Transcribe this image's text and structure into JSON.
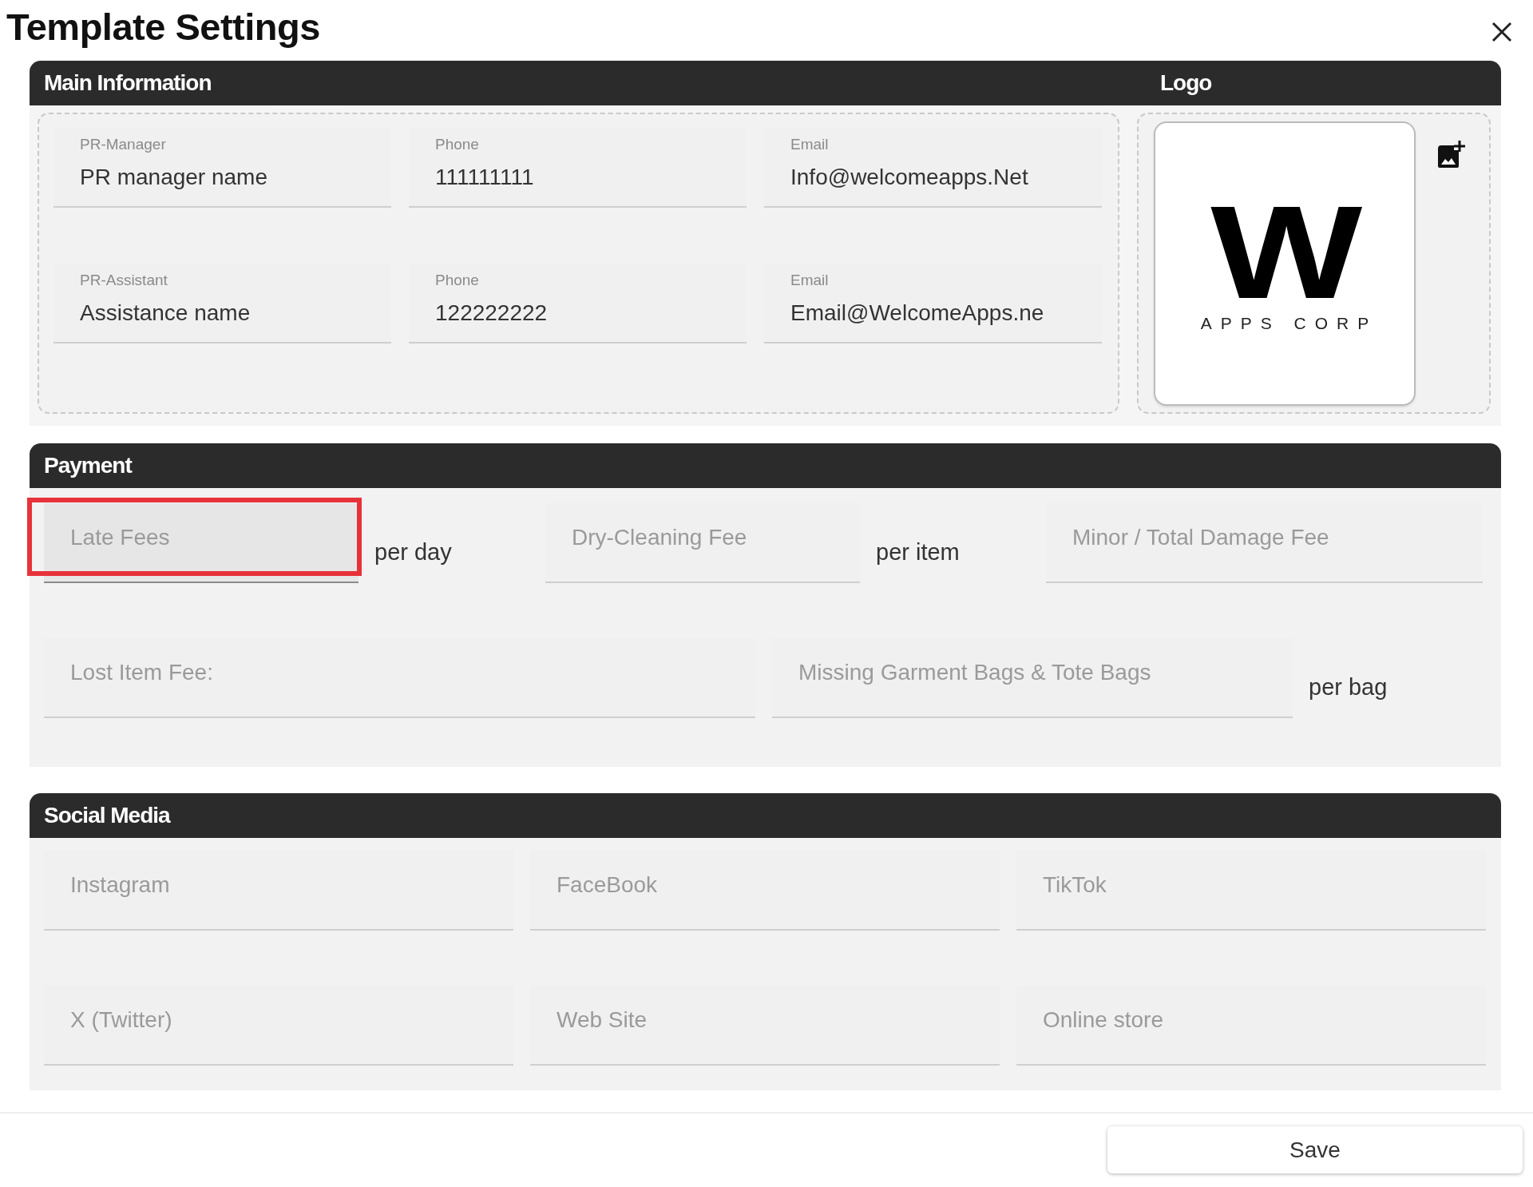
{
  "window": {
    "title": "Template Settings"
  },
  "main_information": {
    "title": "Main Information",
    "fields": [
      {
        "label": "PR-Manager",
        "value": "PR manager name"
      },
      {
        "label": "Phone",
        "value": "111111111"
      },
      {
        "label": "Email",
        "value": "Info@welcomeapps.Net"
      },
      {
        "label": "PR-Assistant",
        "value": "Assistance name"
      },
      {
        "label": "Phone",
        "value": "122222222"
      },
      {
        "label": "Email",
        "value": "Email@WelcomeApps.ne"
      }
    ]
  },
  "logo": {
    "title": "Logo",
    "wordmark": "W",
    "tagline": "APPS CORP"
  },
  "payment": {
    "title": "Payment",
    "fees": [
      {
        "placeholder": "Late Fees",
        "unit": "per day",
        "focused": true,
        "highlighted": true
      },
      {
        "placeholder": "Dry-Cleaning Fee",
        "unit": "per item",
        "focused": false,
        "highlighted": false
      },
      {
        "placeholder": "Minor / Total Damage Fee",
        "focused": false,
        "highlighted": false
      },
      {
        "placeholder": "Lost Item Fee:",
        "focused": false,
        "highlighted": false
      },
      {
        "placeholder": "Missing Garment Bags & Tote Bags",
        "unit": "per bag",
        "focused": false,
        "highlighted": false
      }
    ]
  },
  "social_media": {
    "title": "Social Media",
    "fields": [
      {
        "placeholder": "Instagram"
      },
      {
        "placeholder": "FaceBook"
      },
      {
        "placeholder": "TikTok"
      },
      {
        "placeholder": "X (Twitter)"
      },
      {
        "placeholder": "Web Site"
      },
      {
        "placeholder": "Online store"
      }
    ]
  },
  "buttons": [
    {
      "label": "Save"
    }
  ]
}
